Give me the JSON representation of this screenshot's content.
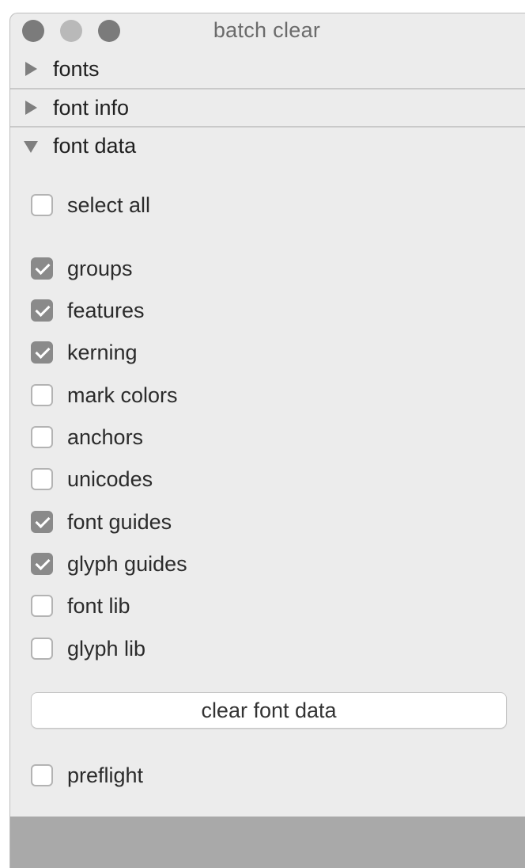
{
  "window": {
    "title": "batch clear"
  },
  "sections": [
    {
      "label": "fonts",
      "expanded": false
    },
    {
      "label": "font info",
      "expanded": false
    },
    {
      "label": "font data",
      "expanded": true
    }
  ],
  "select_all": {
    "label": "select all",
    "checked": false
  },
  "options": [
    {
      "label": "groups",
      "checked": true
    },
    {
      "label": "features",
      "checked": true
    },
    {
      "label": "kerning",
      "checked": true
    },
    {
      "label": "mark colors",
      "checked": false
    },
    {
      "label": "anchors",
      "checked": false
    },
    {
      "label": "unicodes",
      "checked": false
    },
    {
      "label": "font guides",
      "checked": true
    },
    {
      "label": "glyph guides",
      "checked": true
    },
    {
      "label": "font lib",
      "checked": false
    },
    {
      "label": "glyph lib",
      "checked": false
    }
  ],
  "clear_button": {
    "label": "clear font data"
  },
  "preflight": {
    "label": "preflight",
    "checked": false
  },
  "colors": {
    "window_bg": "#ececec",
    "checked_fill": "#8a8a8a",
    "status_bar": "#a9a9a9"
  }
}
